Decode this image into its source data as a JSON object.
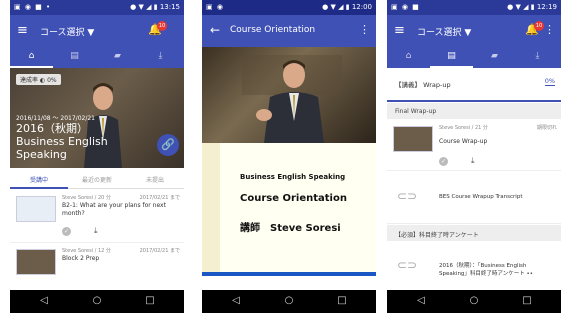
{
  "screen1": {
    "status_time": "13:15",
    "app_title": "コース選択 ▼",
    "hero": {
      "progress_label": "達成率",
      "progress_pct": "0%",
      "dates": "2016/11/08 ～ 2017/02/21",
      "course_title": "2016（秋期） Business English Speaking"
    },
    "subtabs": [
      "受講中",
      "最近の更新",
      "未提出"
    ],
    "lessons": [
      {
        "meta": "Steve Soresi / 20 分",
        "due": "2017/02/21 まで",
        "title": "B2-1: What are your plans for next month?"
      },
      {
        "meta": "Steve Soresi / 12 分",
        "due": "2017/02/21 まで",
        "title": "Block 2 Prep"
      }
    ]
  },
  "screen2": {
    "status_time": "12:00",
    "title": "Course Orientation",
    "slide": {
      "line1": "Business English Speaking",
      "line2": "Course Orientation",
      "line3_role": "講師",
      "line3_name": "Steve Soresi"
    }
  },
  "screen3": {
    "status_time": "12:19",
    "app_title": "コース選択 ▼",
    "header_title": "【講義】 Wrap-up",
    "header_pct": "0%",
    "section1": "Final Wrap-up",
    "item1": {
      "meta": "Steve Soresi / 21 分",
      "due": "期限切れ",
      "title": "Course Wrap-up"
    },
    "item2": {
      "title": "BES Course Wrapup Transcript"
    },
    "section2": "【必須】科目終了時アンケート",
    "item3": {
      "title": "2016（秋期）：「Business English Speaking」科目終了時アンケート ••"
    }
  },
  "nav_icons": [
    "back-icon",
    "home-icon",
    "recents-icon"
  ],
  "colors": {
    "primary": "#3f51b5",
    "status": "#2b3a99",
    "badge": "#e53935"
  }
}
